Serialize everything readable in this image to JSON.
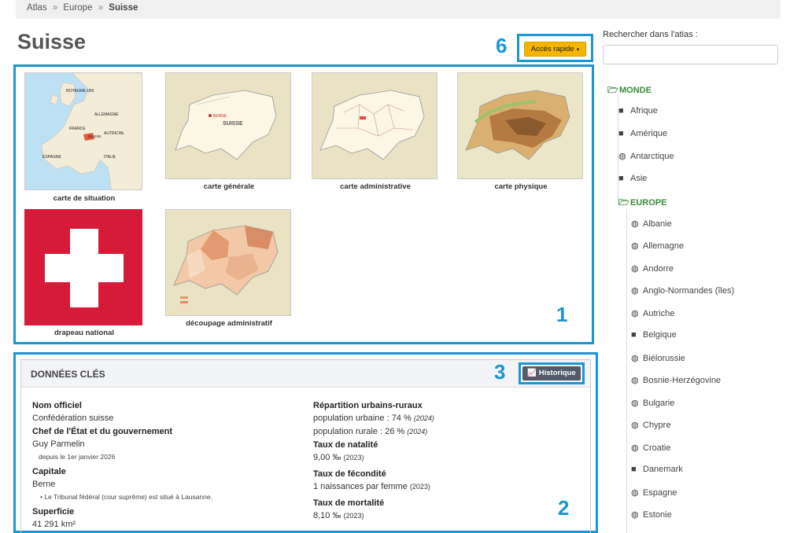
{
  "breadcrumb": {
    "items": [
      "Atlas",
      "Europe"
    ],
    "current": "Suisse",
    "separator": "»"
  },
  "page": {
    "title": "Suisse"
  },
  "annotations": {
    "n1": "1",
    "n2": "2",
    "n3": "3",
    "n6": "6"
  },
  "quick_access": {
    "label": "Accès rapide",
    "caret": "▾"
  },
  "maps": [
    {
      "caption": "carte de situation",
      "thumb_label": ""
    },
    {
      "caption": "carte générale"
    },
    {
      "caption": "carte administrative"
    },
    {
      "caption": "carte physique"
    },
    {
      "caption": "drapeau national"
    },
    {
      "caption": "découpage administratif"
    }
  ],
  "situation_map_labels": [
    "ROYAUME-UNI",
    "ALLEMAGNE",
    "FRANCE",
    "SUISSE",
    "AUTRICHE",
    "ESPAGNE",
    "ITALIE"
  ],
  "general_map_labels": {
    "country": "SUISSE",
    "capital": "BERNE"
  },
  "key_data": {
    "title": "DONNÉES CLÉS",
    "history_button": "Historique",
    "left": {
      "official_name_label": "Nom officiel",
      "official_name": "Confédération suisse",
      "head_label": "Chef de l'État et du gouvernement",
      "head": "Guy Parmelin",
      "head_since": "depuis le 1er janvier 2026",
      "capital_label": "Capitale",
      "capital": "Berne",
      "capital_note": "Le Tribunal fédéral (cour suprême) est situé à Lausanne.",
      "area_label": "Superficie",
      "area": "41 291 km²"
    },
    "right": {
      "urban_label": "Répartition urbains-ruraux",
      "urban": "population urbaine : 74 %",
      "urban_year": "(2024)",
      "rural": "population rurale : 26 %",
      "rural_year": "(2024)",
      "birth_label": "Taux de natalité",
      "birth": "9,00 ‰",
      "birth_year": "(2023)",
      "fertility_label": "Taux de fécondité",
      "fertility": "1 naissances par femme",
      "fertility_year": "(2023)",
      "mortality_label": "Taux de mortalité",
      "mortality": "8,10 ‰",
      "mortality_year": "(2023)"
    }
  },
  "search": {
    "label": "Rechercher dans l'atias :",
    "value": "",
    "placeholder": ""
  },
  "tree": {
    "root": "MONDE",
    "continents": [
      {
        "label": "Afrique",
        "icon": "folder-icon"
      },
      {
        "label": "Amérique",
        "icon": "folder-icon"
      },
      {
        "label": "Antarctique",
        "icon": "globe-icon"
      },
      {
        "label": "Asie",
        "icon": "folder-icon"
      }
    ],
    "open_continent": "EUROPE",
    "countries": [
      {
        "label": "Albanie",
        "icon": "globe-icon"
      },
      {
        "label": "Allemagne",
        "icon": "globe-icon"
      },
      {
        "label": "Andorre",
        "icon": "globe-icon"
      },
      {
        "label": "Anglo-Normandes (îles)",
        "icon": "globe-icon"
      },
      {
        "label": "Autriche",
        "icon": "globe-icon"
      },
      {
        "label": "Belgique",
        "icon": "folder-icon"
      },
      {
        "label": "Biélorussie",
        "icon": "globe-icon"
      },
      {
        "label": "Bosnie-Herzégovine",
        "icon": "globe-icon"
      },
      {
        "label": "Bulgarie",
        "icon": "globe-icon"
      },
      {
        "label": "Chypre",
        "icon": "globe-icon"
      },
      {
        "label": "Croatie",
        "icon": "globe-icon"
      },
      {
        "label": "Danemark",
        "icon": "folder-icon"
      },
      {
        "label": "Espagne",
        "icon": "globe-icon"
      },
      {
        "label": "Estonie",
        "icon": "globe-icon"
      }
    ]
  }
}
